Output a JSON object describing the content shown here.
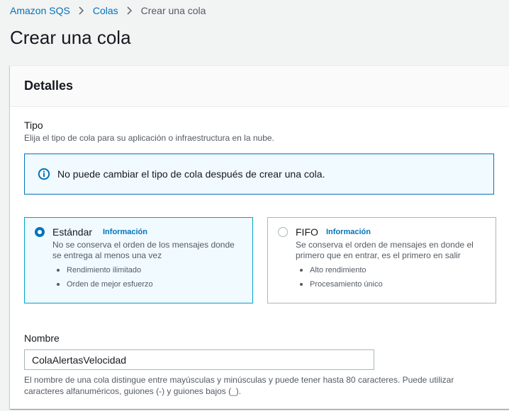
{
  "breadcrumb": {
    "items": [
      "Amazon SQS",
      "Colas"
    ],
    "current": "Crear una cola"
  },
  "page": {
    "title": "Crear una cola"
  },
  "details_panel": {
    "title": "Detalles",
    "type_section": {
      "label": "Tipo",
      "description": "Elija el tipo de cola para su aplicación o infraestructura en la nube.",
      "info_message": "No puede cambiar el tipo de cola después de crear una cola.",
      "options": [
        {
          "title": "Estándar",
          "info_link": "Información",
          "description": "No se conserva el orden de los mensajes donde se entrega al menos una vez",
          "bullets": [
            "Rendimiento ilimitado",
            "Orden de mejor esfuerzo"
          ],
          "selected": true
        },
        {
          "title": "FIFO",
          "info_link": "Información",
          "description": "Se conserva el orden de mensajes en donde el primero que en entrar, es el primero en salir",
          "bullets": [
            "Alto rendimiento",
            "Procesamiento único"
          ],
          "selected": false
        }
      ]
    },
    "name_section": {
      "label": "Nombre",
      "value": "ColaAlertasVelocidad",
      "hint": "El nombre de una cola distingue entre mayúsculas y minúsculas y puede tener hasta 80 caracteres. Puede utilizar caracteres alfanuméricos, guiones (-) y guiones bajos (_)."
    }
  },
  "colors": {
    "link": "#0073bb",
    "selected_bg": "#f1faff",
    "selected_border": "#00a1c9"
  },
  "icons": {
    "separator": "chevron-right-icon",
    "info": "info-icon"
  }
}
